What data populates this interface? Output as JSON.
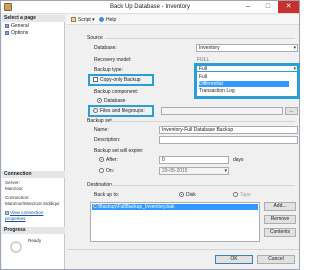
{
  "window": {
    "title": "Back Up Database - Inventory",
    "minimize_glyph": "–",
    "maximize_glyph": "□",
    "close_glyph": "✕"
  },
  "left_pane": {
    "select_page_header": "Select a page",
    "pages": [
      {
        "label": "General",
        "icon": "page-icon"
      },
      {
        "label": "Options",
        "icon": "page-icon"
      }
    ],
    "connection_header": "Connection",
    "server_label": "Server:",
    "server_value": "Manzoor",
    "connection_label": "Connection:",
    "connection_value": "Manzoor\\Manzoor.Siddiqui",
    "view_connection_link": "View connection properties",
    "progress_header": "Progress",
    "progress_status": "Ready"
  },
  "toolbar": {
    "script_label": "Script",
    "script_arrow": "▾",
    "help_label": "Help"
  },
  "source": {
    "section_title": "Source",
    "database_label": "Database:",
    "database_value": "Inventory",
    "recovery_model_label": "Recovery model:",
    "recovery_model_value": "FULL",
    "backup_type_label": "Backup type:",
    "backup_type_value": "Full",
    "backup_type_options": [
      "Full",
      "Differential",
      "Transaction Log"
    ],
    "backup_type_selected_index": 1,
    "copy_only_label": "Copy-only Backup",
    "copy_only_checked": false,
    "backup_component_label": "Backup component:",
    "component_database_label": "Database",
    "component_files_label": "Files and filegroups:",
    "component_selected": "Database",
    "browse_button_label": "..."
  },
  "backup_set": {
    "section_title": "Backup set",
    "name_label": "Name:",
    "name_value": "Inventory-Full Database Backup",
    "description_label": "Description:",
    "description_value": "",
    "expire_label": "Backup set will expire:",
    "after_label": "After:",
    "after_value": "0",
    "after_unit": "days",
    "on_label": "On:",
    "on_value": "29-05-2015",
    "expire_selected": "After"
  },
  "destination": {
    "section_title": "Destination",
    "back_up_to_label": "Back up to:",
    "disk_label": "Disk",
    "tape_label": "Tape",
    "selected": "Disk",
    "paths": [
      "C:\\Backup\\FullBackup_Inventory.bak"
    ],
    "add_button": "Add...",
    "remove_button": "Remove",
    "contents_button": "Contents"
  },
  "footer": {
    "ok_button": "OK",
    "cancel_button": "Cancel"
  },
  "colors": {
    "highlight": "#2a9fd6",
    "selection": "#3399ff",
    "close_button": "#c7302c"
  }
}
